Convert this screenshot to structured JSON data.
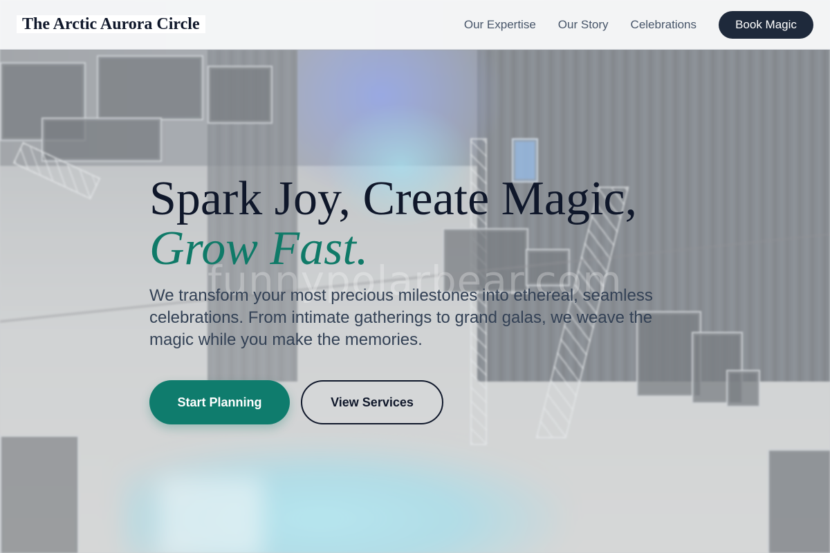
{
  "header": {
    "brand": "The Arctic Aurora Circle",
    "nav": [
      {
        "label": "Our Expertise"
      },
      {
        "label": "Our Story"
      },
      {
        "label": "Celebrations"
      }
    ],
    "cta_label": "Book Magic"
  },
  "hero": {
    "headline_line1": "Spark Joy, Create Magic,",
    "headline_line2": "Grow Fast.",
    "subtitle": "We transform your most precious milestones into ethereal, seamless celebrations. From intimate gatherings to grand galas, we weave the magic while you make the memories.",
    "primary_button": "Start Planning",
    "secondary_button": "View Services"
  },
  "background": {
    "watermark": "funnypolarbear.com"
  },
  "colors": {
    "navy": "#1e293b",
    "teal_accent": "#0f7a68",
    "primary_button": "#0f7c6d",
    "heading": "#0f172a",
    "body_text": "#334155",
    "nav_text": "#475569"
  }
}
